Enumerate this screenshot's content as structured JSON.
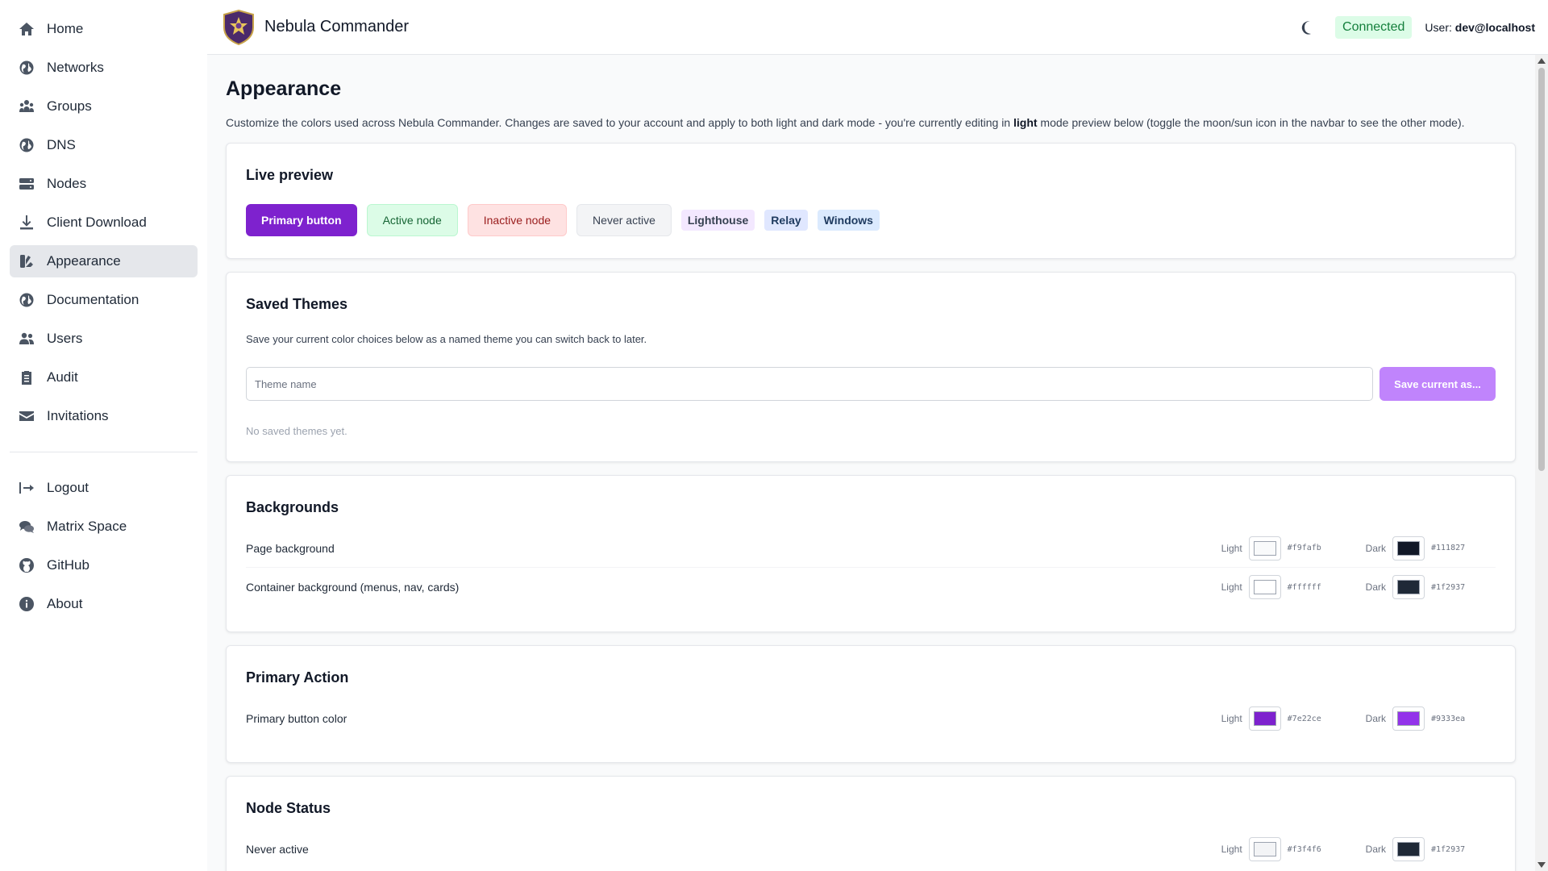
{
  "app": {
    "title": "Nebula Commander"
  },
  "topbar": {
    "status": "Connected",
    "user_prefix": "User:",
    "user_name": "dev@localhost"
  },
  "sidebar": {
    "items": [
      {
        "label": "Home",
        "icon": "home-icon"
      },
      {
        "label": "Networks",
        "icon": "globe-icon"
      },
      {
        "label": "Groups",
        "icon": "people-group-icon"
      },
      {
        "label": "DNS",
        "icon": "globe-icon"
      },
      {
        "label": "Nodes",
        "icon": "server-icon"
      },
      {
        "label": "Client Download",
        "icon": "download-icon"
      },
      {
        "label": "Appearance",
        "icon": "palette-icon"
      },
      {
        "label": "Documentation",
        "icon": "globe-icon"
      },
      {
        "label": "Users",
        "icon": "users-icon"
      },
      {
        "label": "Audit",
        "icon": "clipboard-list-icon"
      },
      {
        "label": "Invitations",
        "icon": "envelope-icon"
      }
    ],
    "footer_items": [
      {
        "label": "Logout",
        "icon": "logout-icon"
      },
      {
        "label": "Matrix Space",
        "icon": "chat-bubbles-icon"
      },
      {
        "label": "GitHub",
        "icon": "github-icon"
      },
      {
        "label": "About",
        "icon": "info-icon"
      }
    ]
  },
  "page": {
    "title": "Appearance",
    "desc_before": "Customize the colors used across Nebula Commander. Changes are saved to your account and apply to both light and dark mode - you're currently editing in ",
    "desc_mode": "light",
    "desc_after": " mode preview below (toggle the moon/sun icon in the navbar to see the other mode)."
  },
  "preview": {
    "title": "Live preview",
    "primary_button": "Primary button",
    "active_node": "Active node",
    "inactive_node": "Inactive node",
    "never_active": "Never active",
    "tags": [
      "Lighthouse",
      "Relay",
      "Windows"
    ]
  },
  "themes": {
    "title": "Saved Themes",
    "desc": "Save your current color choices below as a named theme you can switch back to later.",
    "input_placeholder": "Theme name",
    "save_label": "Save current as...",
    "empty": "No saved themes yet."
  },
  "colors": {
    "light_label": "Light",
    "dark_label": "Dark",
    "backgrounds": {
      "title": "Backgrounds",
      "rows": [
        {
          "label": "Page background",
          "light": "#f9fafb",
          "dark": "#111827"
        },
        {
          "label": "Container background (menus, nav, cards)",
          "light": "#ffffff",
          "dark": "#1f2937"
        }
      ]
    },
    "primary": {
      "title": "Primary Action",
      "rows": [
        {
          "label": "Primary button color",
          "light": "#7e22ce",
          "dark": "#9333ea"
        }
      ]
    },
    "node_status": {
      "title": "Node Status",
      "rows": [
        {
          "label": "Never active",
          "light": "#f3f4f6",
          "dark": "#1f2937"
        }
      ]
    }
  }
}
